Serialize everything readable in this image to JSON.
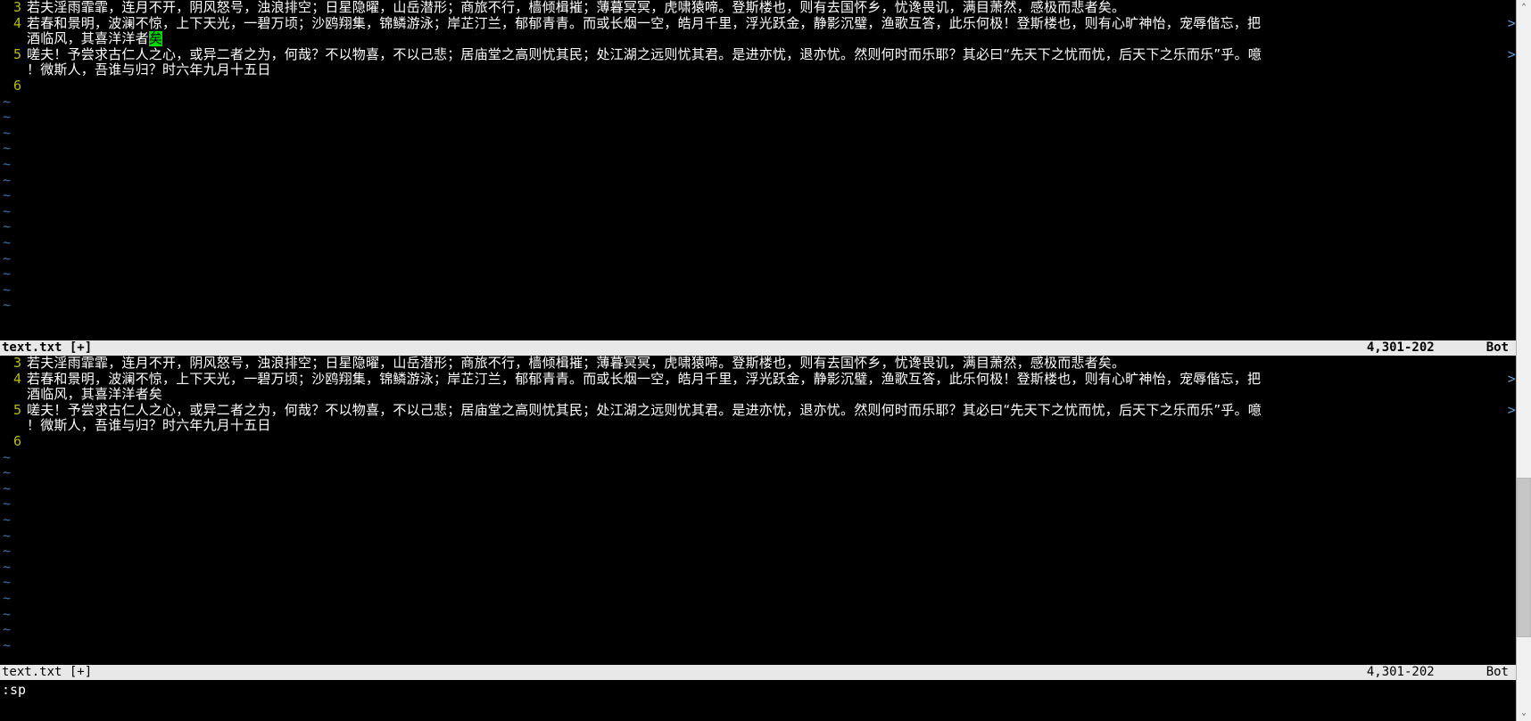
{
  "editor": {
    "name": "vim",
    "filename": "text.txt",
    "modified_flag": "[+]",
    "status_label": "text.txt [+]",
    "cursor_position": "4,301-202",
    "scroll_percent": "Bot",
    "command_line": ":sp",
    "wrap_marker": ">",
    "tilde": "~",
    "colors": {
      "background": "#000000",
      "foreground": "#ffffff",
      "line_number": "#bbbb00",
      "tilde": "#3a6ea5",
      "cursor": "#00dd00",
      "statusline_bg": "#e8e8e8",
      "statusline_fg": "#000000",
      "wrap_marker": "#5c9fd8"
    }
  },
  "panes": [
    {
      "id": "top-pane",
      "active": true,
      "lines": [
        {
          "number": "3",
          "segments": [
            {
              "text": "若夫淫雨霏霏，连月不开，阴风怒号，浊浪排空；日星隐曜，山岳潜形；商旅不行，樯倾楫摧；薄暮冥冥，虎啸猿啼。登斯楼也，则有去国怀乡，忧谗畏讥，满目萧然，感极而悲者矣。",
              "style": "normal"
            }
          ],
          "wrapped": false,
          "wrap_marker": ""
        },
        {
          "number": "4",
          "segments": [
            {
              "text": "若春和景明，波澜不惊，上下天光，一碧万顷；沙鸥翔集，锦鳞游泳；岸芷汀兰，郁郁青青。而或长烟一空，皓月千里，浮光跃金，静影沉璧，渔歌互答，此乐何极！登斯楼也，则有心旷神怡，宠辱偕忘，把",
              "style": "normal"
            }
          ],
          "wrapped": true,
          "wrap_marker": ">"
        },
        {
          "number": "",
          "segments": [
            {
              "text": "酒临风，其喜洋洋者",
              "style": "normal"
            },
            {
              "text": "矣",
              "style": "cursor"
            }
          ],
          "wrapped": false,
          "wrap_marker": ""
        },
        {
          "number": "5",
          "segments": [
            {
              "text": "嗟夫！予尝求古仁人之心，或异二者之为，何哉？不以物喜，不以己悲；居庙堂之高则忧其民；处江湖之远则忧其君。是进亦忧，退亦忧。然则何时而乐耶？其必曰“先天下之忧而忧，后天下之乐而乐”乎。噫",
              "style": "normal"
            }
          ],
          "wrapped": true,
          "wrap_marker": ">"
        },
        {
          "number": "",
          "segments": [
            {
              "text": "！微斯人，吾谁与归？时六年九月十五日",
              "style": "normal"
            }
          ],
          "wrapped": false,
          "wrap_marker": ""
        },
        {
          "number": "6",
          "segments": [
            {
              "text": "",
              "style": "normal"
            }
          ],
          "wrapped": false,
          "wrap_marker": ""
        }
      ],
      "empty_line_count": 14,
      "statusline": {
        "name": "text.txt [+]",
        "position": "4,301-202",
        "scroll": "Bot"
      }
    },
    {
      "id": "bottom-pane",
      "active": false,
      "lines": [
        {
          "number": "3",
          "segments": [
            {
              "text": "若夫淫雨霏霏，连月不开，阴风怒号，浊浪排空；日星隐曜，山岳潜形；商旅不行，樯倾楫摧；薄暮冥冥，虎啸猿啼。登斯楼也，则有去国怀乡，忧谗畏讥，满目萧然，感极而悲者矣。",
              "style": "normal"
            }
          ],
          "wrapped": false,
          "wrap_marker": ""
        },
        {
          "number": "4",
          "segments": [
            {
              "text": "若春和景明，波澜不惊，上下天光，一碧万顷；沙鸥翔集，锦鳞游泳；岸芷汀兰，郁郁青青。而或长烟一空，皓月千里，浮光跃金，静影沉璧，渔歌互答，此乐何极！登斯楼也，则有心旷神怡，宠辱偕忘，把",
              "style": "normal"
            }
          ],
          "wrapped": true,
          "wrap_marker": ">"
        },
        {
          "number": "",
          "segments": [
            {
              "text": "酒临风，其喜洋洋者矣",
              "style": "normal"
            }
          ],
          "wrapped": false,
          "wrap_marker": ""
        },
        {
          "number": "5",
          "segments": [
            {
              "text": "嗟夫！予尝求古仁人之心，或异二者之为，何哉？不以物喜，不以己悲；居庙堂之高则忧其民；处江湖之远则忧其君。是进亦忧，退亦忧。然则何时而乐耶？其必曰“先天下之忧而忧，后天下之乐而乐”乎。噫",
              "style": "normal"
            }
          ],
          "wrapped": true,
          "wrap_marker": ">"
        },
        {
          "number": "",
          "segments": [
            {
              "text": "！微斯人，吾谁与归？时六年九月十五日",
              "style": "normal"
            }
          ],
          "wrapped": false,
          "wrap_marker": ""
        },
        {
          "number": "6",
          "segments": [
            {
              "text": "",
              "style": "normal"
            }
          ],
          "wrapped": false,
          "wrap_marker": ""
        }
      ],
      "empty_line_count": 13,
      "statusline": {
        "name": "text.txt [+]",
        "position": "4,301-202",
        "scroll": "Bot"
      }
    }
  ],
  "scrollbar": {
    "up_arrow": "⌃",
    "down_arrow": "⌄",
    "thumb_top_percent": 67,
    "thumb_height_percent": 23
  }
}
